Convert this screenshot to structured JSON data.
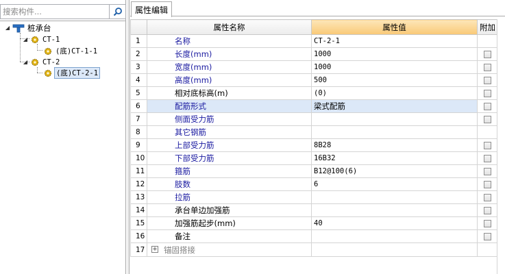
{
  "search": {
    "placeholder": "搜索构件..."
  },
  "tree": {
    "root": "桩承台",
    "items": [
      {
        "label": "CT-1"
      },
      {
        "label": "(底)CT-1-1"
      },
      {
        "label": "CT-2"
      },
      {
        "label": "(底)CT-2-1"
      }
    ]
  },
  "tabs": [
    {
      "label": "属性编辑"
    }
  ],
  "grid": {
    "headers": {
      "name": "属性名称",
      "value": "属性值",
      "extra": "附加"
    },
    "rows": [
      {
        "num": "1",
        "name": "名称",
        "value": "CT-2-1"
      },
      {
        "num": "2",
        "name": "长度(mm)",
        "value": "1000"
      },
      {
        "num": "3",
        "name": "宽度(mm)",
        "value": "1000"
      },
      {
        "num": "4",
        "name": "高度(mm)",
        "value": "500"
      },
      {
        "num": "5",
        "name": "相对底标高(m)",
        "value": "(0)"
      },
      {
        "num": "6",
        "name": "配筋形式",
        "value": "梁式配筋"
      },
      {
        "num": "7",
        "name": "侧面受力筋",
        "value": ""
      },
      {
        "num": "8",
        "name": "其它钢筋",
        "value": ""
      },
      {
        "num": "9",
        "name": "上部受力筋",
        "value": "8B28"
      },
      {
        "num": "10",
        "name": "下部受力筋",
        "value": "16B32"
      },
      {
        "num": "11",
        "name": "箍筋",
        "value": "B12@100(6)"
      },
      {
        "num": "12",
        "name": "肢数",
        "value": "6"
      },
      {
        "num": "13",
        "name": "拉筋",
        "value": ""
      },
      {
        "num": "14",
        "name": "承台单边加强筋",
        "value": ""
      },
      {
        "num": "15",
        "name": "加强筋起步(mm)",
        "value": "40"
      },
      {
        "num": "16",
        "name": "备注",
        "value": ""
      },
      {
        "num": "17",
        "name": "锚固搭接",
        "value": ""
      }
    ]
  },
  "colors": {
    "selection": "#dce8f8",
    "header_highlight": "#f9c977",
    "link_blue": "#1a1aa0"
  }
}
